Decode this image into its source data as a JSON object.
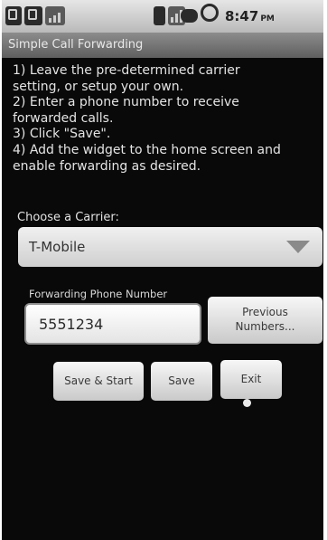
{
  "status_bar": {
    "time": "8:47",
    "ampm": "PM"
  },
  "app": {
    "title": "Simple Call Forwarding"
  },
  "instructions": [
    "1) Leave the pre-determined carrier",
    "setting, or setup your own.",
    "2) Enter a phone number to receive",
    "forwarded calls.",
    "3) Click \"Save\".",
    "4) Add the widget to the home screen and",
    "enable forwarding as desired."
  ],
  "carrier": {
    "label": "Choose a Carrier:",
    "selected": "T-Mobile"
  },
  "forwarding": {
    "label": "Forwarding Phone Number",
    "value": "5551234",
    "previous_line1": "Previous",
    "previous_line2": "Numbers..."
  },
  "actions": {
    "save_start": "Save & Start",
    "save": "Save",
    "exit": "Exit"
  }
}
